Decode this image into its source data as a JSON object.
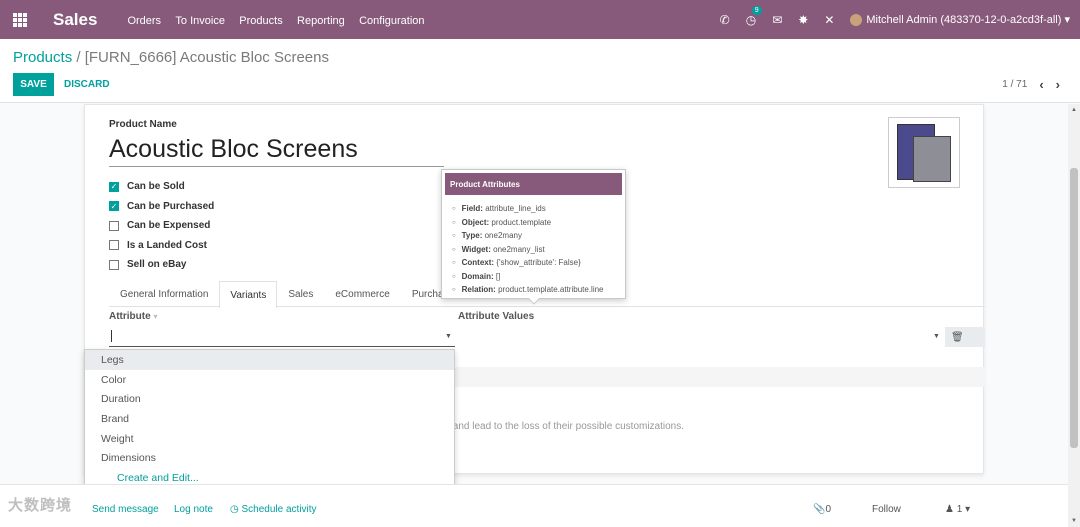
{
  "navbar": {
    "app_name": "Sales",
    "menu": [
      "Orders",
      "To Invoice",
      "Products",
      "Reporting",
      "Configuration"
    ],
    "notification_count": "9",
    "user": "Mitchell Admin (483370-12-0-a2cd3f-all)"
  },
  "breadcrumb": {
    "parent": "Products",
    "separator": "/",
    "current": "[FURN_6666] Acoustic Bloc Screens"
  },
  "buttons": {
    "save": "SAVE",
    "discard": "DISCARD"
  },
  "pager": {
    "text": "1 / 71"
  },
  "form": {
    "product_name_label": "Product Name",
    "product_name": "Acoustic Bloc Screens",
    "checkboxes": [
      {
        "label": "Can be Sold",
        "checked": true
      },
      {
        "label": "Can be Purchased",
        "checked": true
      },
      {
        "label": "Can be Expensed",
        "checked": false
      },
      {
        "label": "Is a Landed Cost",
        "checked": false
      },
      {
        "label": "Sell on eBay",
        "checked": false
      }
    ],
    "tabs": [
      "General Information",
      "Variants",
      "Sales",
      "eCommerce",
      "Purchase"
    ],
    "active_tab": "Variants",
    "grid": {
      "col_attribute": "Attribute",
      "col_values": "Attribute Values"
    },
    "warning_fragment": "its and lead to the loss of their possible customizations."
  },
  "tooltip": {
    "title": "Product Attributes",
    "rows": [
      {
        "key": "Field:",
        "value": "attribute_line_ids"
      },
      {
        "key": "Object:",
        "value": "product.template"
      },
      {
        "key": "Type:",
        "value": "one2many"
      },
      {
        "key": "Widget:",
        "value": "one2many_list"
      },
      {
        "key": "Context:",
        "value": "{'show_attribute': False}"
      },
      {
        "key": "Domain:",
        "value": "[]"
      },
      {
        "key": "Relation:",
        "value": "product.template.attribute.line"
      }
    ]
  },
  "dropdown": {
    "items": [
      "Legs",
      "Color",
      "Duration",
      "Brand",
      "Weight",
      "Dimensions"
    ],
    "create_edit": "Create and Edit..."
  },
  "chatter": {
    "send_message": "Send message",
    "log_note": "Log note",
    "schedule_activity": "Schedule activity",
    "attachments": "0",
    "follow": "Follow",
    "followers": "1"
  },
  "watermark": "大数跨境",
  "colors": {
    "brand": "#875a7b",
    "accent": "#00a09d"
  }
}
